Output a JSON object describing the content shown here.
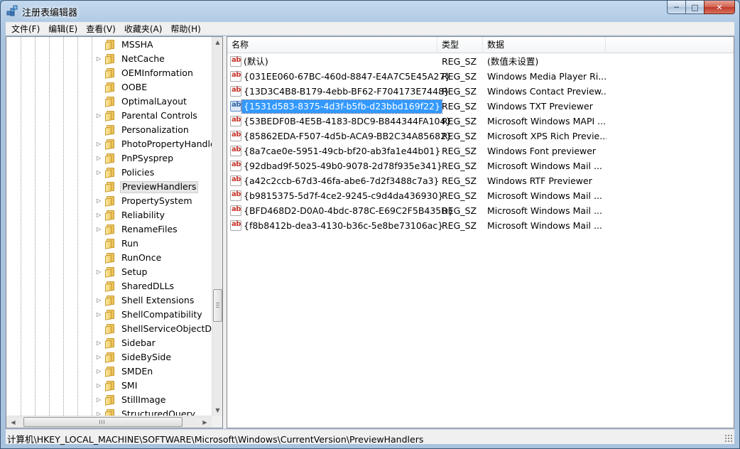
{
  "window": {
    "title": "注册表编辑器",
    "caption": {
      "minimize": "─",
      "maximize": "□",
      "close": "✕"
    }
  },
  "menu": [
    "文件(F)",
    "编辑(E)",
    "查看(V)",
    "收藏夹(A)",
    "帮助(H)"
  ],
  "tree": {
    "items": [
      {
        "label": "MSSHA",
        "expandable": false
      },
      {
        "label": "NetCache",
        "expandable": true
      },
      {
        "label": "OEMInformation",
        "expandable": false
      },
      {
        "label": "OOBE",
        "expandable": false
      },
      {
        "label": "OptimalLayout",
        "expandable": false
      },
      {
        "label": "Parental Controls",
        "expandable": true
      },
      {
        "label": "Personalization",
        "expandable": false
      },
      {
        "label": "PhotoPropertyHandler",
        "expandable": true
      },
      {
        "label": "PnPSysprep",
        "expandable": true
      },
      {
        "label": "Policies",
        "expandable": true
      },
      {
        "label": "PreviewHandlers",
        "expandable": false,
        "selected": true
      },
      {
        "label": "PropertySystem",
        "expandable": true
      },
      {
        "label": "Reliability",
        "expandable": true
      },
      {
        "label": "RenameFiles",
        "expandable": true
      },
      {
        "label": "Run",
        "expandable": false
      },
      {
        "label": "RunOnce",
        "expandable": false
      },
      {
        "label": "Setup",
        "expandable": true
      },
      {
        "label": "SharedDLLs",
        "expandable": false
      },
      {
        "label": "Shell Extensions",
        "expandable": true
      },
      {
        "label": "ShellCompatibility",
        "expandable": true
      },
      {
        "label": "ShellServiceObjectDelayLoad",
        "expandable": false
      },
      {
        "label": "Sidebar",
        "expandable": true
      },
      {
        "label": "SideBySide",
        "expandable": true
      },
      {
        "label": "SMDEn",
        "expandable": true
      },
      {
        "label": "SMI",
        "expandable": true
      },
      {
        "label": "StillImage",
        "expandable": true
      },
      {
        "label": "StructuredQuery",
        "expandable": true
      }
    ],
    "expander_glyph": "▷"
  },
  "list": {
    "columns": {
      "name": "名称",
      "type": "类型",
      "data": "数据"
    },
    "icon_text": "ab",
    "rows": [
      {
        "name": "(默认)",
        "type": "REG_SZ",
        "data": "(数值未设置)"
      },
      {
        "name": "{031EE060-67BC-460d-8847-E4A7C5E45A27}",
        "type": "REG_SZ",
        "data": "Windows Media Player Ri..."
      },
      {
        "name": "{13D3C4B8-B179-4ebb-BF62-F704173E7448}",
        "type": "REG_SZ",
        "data": "Windows Contact Preview..."
      },
      {
        "name": "{1531d583-8375-4d3f-b5fb-d23bbd169f22}",
        "type": "REG_SZ",
        "data": "Windows TXT Previewer",
        "selected": true
      },
      {
        "name": "{53BEDF0B-4E5B-4183-8DC9-B844344FA104}",
        "type": "REG_SZ",
        "data": "Microsoft Windows MAPI ..."
      },
      {
        "name": "{85862EDA-F507-4d5b-ACA9-BB2C34A85682}",
        "type": "REG_SZ",
        "data": "Microsoft XPS Rich Previe..."
      },
      {
        "name": "{8a7cae0e-5951-49cb-bf20-ab3fa1e44b01}",
        "type": "REG_SZ",
        "data": "Windows Font previewer"
      },
      {
        "name": "{92dbad9f-5025-49b0-9078-2d78f935e341}",
        "type": "REG_SZ",
        "data": "Microsoft Windows Mail ..."
      },
      {
        "name": "{a42c2ccb-67d3-46fa-abe6-7d2f3488c7a3}",
        "type": "REG_SZ",
        "data": "Windows RTF Previewer"
      },
      {
        "name": "{b9815375-5d7f-4ce2-9245-c9d4da436930}",
        "type": "REG_SZ",
        "data": "Microsoft Windows Mail ..."
      },
      {
        "name": "{BFD468D2-D0A0-4bdc-878C-E69C2F5B435D}",
        "type": "REG_SZ",
        "data": "Microsoft Windows Mail ..."
      },
      {
        "name": "{f8b8412b-dea3-4130-b36c-5e8be73106ac}",
        "type": "REG_SZ",
        "data": "Microsoft Windows Mail ..."
      }
    ]
  },
  "status": {
    "path": "计算机\\HKEY_LOCAL_MACHINE\\SOFTWARE\\Microsoft\\Windows\\CurrentVersion\\PreviewHandlers"
  },
  "scrollbar": {
    "up": "▲",
    "down": "▼",
    "left": "◀",
    "right": "▶"
  },
  "colors": {
    "selection": "#3399ff",
    "icon_red": "#c8352b",
    "close": "#c0392b"
  }
}
